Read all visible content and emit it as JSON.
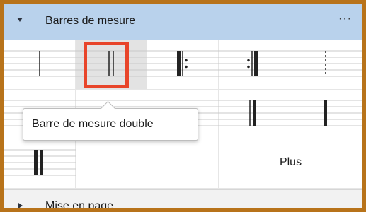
{
  "panel": {
    "title": "Barres de mesure",
    "more_label": "···",
    "more_icon": "more-horizontal-icon",
    "collapse_icon": "caret-down-icon"
  },
  "palette": {
    "items": [
      {
        "name": "single-barline",
        "icon": "single-barline-icon"
      },
      {
        "name": "double-barline",
        "icon": "double-barline-icon",
        "selected": true
      },
      {
        "name": "start-repeat",
        "icon": "start-repeat-barline-icon"
      },
      {
        "name": "end-repeat",
        "icon": "end-repeat-barline-icon"
      },
      {
        "name": "dashed-barline",
        "icon": "dashed-barline-icon"
      },
      {
        "name": "final-barline",
        "icon": "final-barline-icon"
      },
      {
        "name": "heavy-barline",
        "icon": "heavy-barline-icon"
      },
      {
        "name": "heavy-double-barline",
        "icon": "heavy-double-barline-icon"
      }
    ],
    "more_button_label": "Plus"
  },
  "tooltip": {
    "text": "Barre de mesure double"
  },
  "next_section": {
    "title": "Mise en page",
    "expand_icon": "caret-right-icon"
  },
  "colors": {
    "header_bg": "#b9d2ec",
    "selection_border": "#e8452a",
    "frame": "#b8731a"
  }
}
